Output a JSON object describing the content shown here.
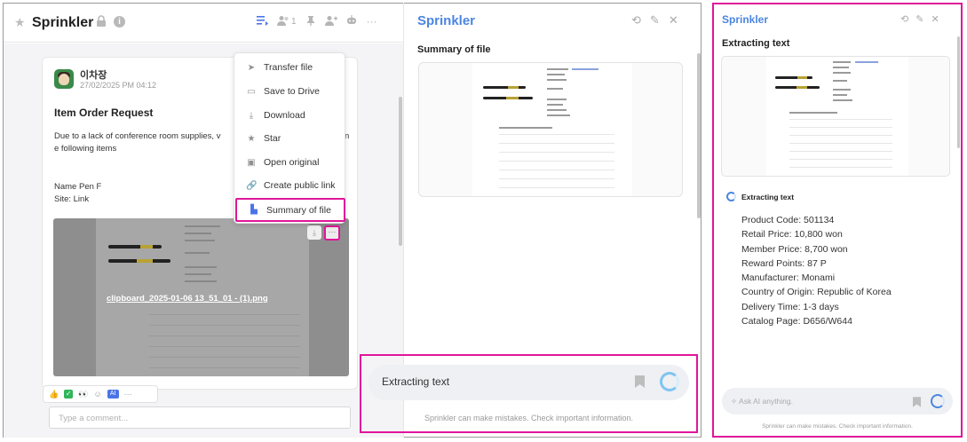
{
  "chat": {
    "app_title": "Sprinkler",
    "member_count": "1",
    "message": {
      "sender": "이차장",
      "time": "27/02/2025 PM 04:12",
      "title": "Item Order Request",
      "body_line1": "Due to a lack of conference room supplies, v",
      "body_line1_tail": "n",
      "body_line2": "e following items",
      "name_line": "Name Pen F",
      "site_line": "Site: Link",
      "attachment_name": "clipboard_2025-01-06 13_51_01 - (1).png",
      "attach_more": "···"
    },
    "reaction_more": "···",
    "comment_placeholder": "Type a comment..."
  },
  "menu": {
    "items": [
      {
        "label": "Transfer file",
        "icon": "send-icon"
      },
      {
        "label": "Save to Drive",
        "icon": "drive-icon"
      },
      {
        "label": "Download",
        "icon": "download-icon"
      },
      {
        "label": "Star",
        "icon": "star-icon"
      },
      {
        "label": "Open original",
        "icon": "open-original-icon"
      },
      {
        "label": "Create public link",
        "icon": "link-icon"
      },
      {
        "label": "Summary of file",
        "icon": "file-icon"
      }
    ],
    "highlighted_index": 6
  },
  "middle": {
    "title": "Sprinkler",
    "heading": "Summary of file",
    "input_text": "Extracting text",
    "disclaimer": "Sprinkler can make mistakes. Check important information."
  },
  "right": {
    "title": "Sprinkler",
    "heading": "Extracting text",
    "status": "Extracting text",
    "lines": [
      "Product Code: 501134",
      "Retail Price: 10,800 won",
      "Member Price: 8,700 won",
      "Reward Points: 87 P",
      "Manufacturer: Monami",
      "Country of Origin: Republic of Korea",
      "Delivery Time: 1-3 days",
      "Catalog Page: D656/W644"
    ],
    "input_placeholder": "Ask AI anything.",
    "disclaimer": "Sprinkler can make mistakes. Check important information."
  },
  "colors": {
    "accent": "#4b86e0",
    "highlight": "#e0169a",
    "spinner": "#7ec3f3"
  }
}
